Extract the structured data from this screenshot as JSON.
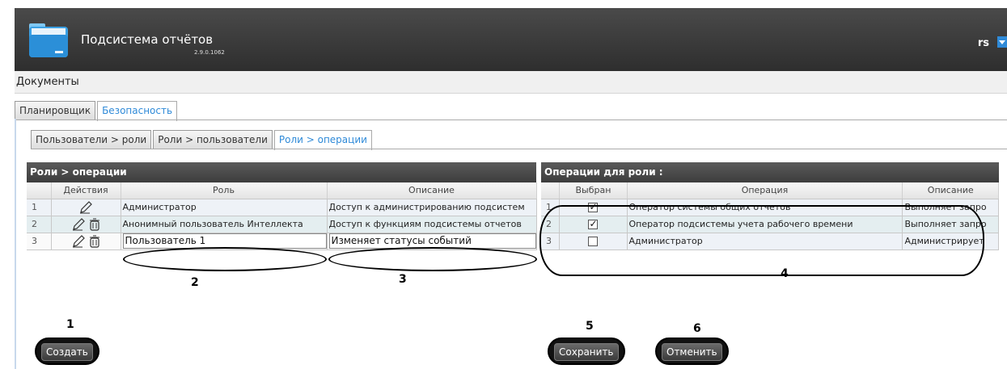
{
  "header": {
    "title": "Подсистема отчётов",
    "version": "2.9.0.1062",
    "user": "rs"
  },
  "menu": {
    "documents": "Документы"
  },
  "tabs_main": [
    {
      "label": "Планировщик"
    },
    {
      "label": "Безопасность"
    }
  ],
  "tabs_security": [
    {
      "label": "Пользователи > роли"
    },
    {
      "label": "Роли > пользователи"
    },
    {
      "label": "Роли > операции"
    }
  ],
  "roles_panel": {
    "title": "Роли > операции",
    "columns": {
      "actions": "Действия",
      "role": "Роль",
      "description": "Описание"
    },
    "rows": [
      {
        "num": "1",
        "role": "Администратор",
        "description": "Доступ к администрированию подсистем"
      },
      {
        "num": "2",
        "role": "Анонимный пользователь Интеллекта",
        "description": "Доступ к функциям подсистемы отчетов"
      },
      {
        "num": "3",
        "role": "Пользователь 1",
        "description": "Изменяет статусы событий"
      }
    ]
  },
  "ops_panel": {
    "title": "Операции для роли :",
    "columns": {
      "selected": "Выбран",
      "operation": "Операция",
      "description": "Описание"
    },
    "rows": [
      {
        "num": "1",
        "checked": true,
        "operation": "Оператор системы общих отчетов",
        "description": "Выполняет запро"
      },
      {
        "num": "2",
        "checked": true,
        "operation": "Оператор подсистемы учета рабочего времени",
        "description": "Выполняет запро"
      },
      {
        "num": "3",
        "checked": false,
        "operation": "Администратор",
        "description": "Администрирует"
      }
    ]
  },
  "buttons": {
    "create": "Создать",
    "save": "Сохранить",
    "cancel": "Отменить"
  },
  "callouts": [
    "1",
    "2",
    "3",
    "4",
    "5",
    "6"
  ],
  "colors": {
    "header_bg": "#3a3a3a",
    "accent": "#2f8ad8",
    "panel_header": "#444444"
  }
}
